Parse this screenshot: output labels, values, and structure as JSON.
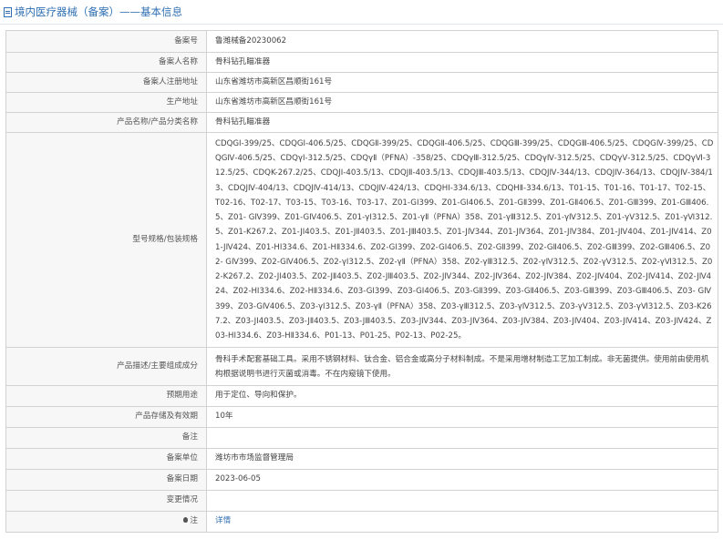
{
  "header": {
    "title": "境内医疗器械（备案）——基本信息",
    "icon": "document-icon"
  },
  "rows": [
    {
      "label": "备案号",
      "value": "鲁潍械备20230062"
    },
    {
      "label": "备案人名称",
      "value": "骨科钻孔瞄准器"
    },
    {
      "label": "备案人注册地址",
      "value": "山东省潍坊市高新区昌顺街161号"
    },
    {
      "label": "生产地址",
      "value": "山东省潍坊市高新区昌顺街161号"
    },
    {
      "label": "产品名称/产品分类名称",
      "value": "骨科钻孔瞄准器"
    },
    {
      "label": "型号规格/包装规格",
      "value": "CDQGⅠ-399/25、CDQGⅠ-406.5/25、CDQGⅡ-399/25、CDQGⅡ-406.5/25、CDQGⅢ-399/25、CDQGⅢ-406.5/25、CDQGⅣ-399/25、CDQGⅣ-406.5/25、CDQγⅠ-312.5/25、CDQγⅡ（PFNA）-358/25、CDQγⅢ-312.5/25、CDQγⅣ-312.5/25、CDQγⅤ-312.5/25、CDQγⅥ-312.5/25、CDQK-267.2/25、CDQJⅠ-403.5/13、CDQJⅡ-403.5/13、CDQJⅢ-403.5/13、CDQJⅣ-344/13、CDQJⅣ-364/13、CDQJⅣ-384/13、CDQJⅣ-404/13、CDQJⅣ-414/13、CDQJⅣ-424/13、CDQHⅠ-334.6/13、CDQHⅡ-334.6/13、T01-15、T01-16、T01-17、T02-15、T02-16、T02-17、T03-15、T03-16、T03-17、Z01-GⅠ399、Z01-GⅠ406.5、Z01-GⅡ399、Z01-GⅡ406.5、Z01-GⅢ399、Z01-GⅢ406.5、Z01- GⅣ399、Z01-GⅣ406.5、Z01-γⅠ312.5、Z01-γⅡ（PFNA）358、Z01-γⅢ312.5、Z01-γⅣ312.5、Z01-γⅤ312.5、Z01-γⅥ312.5、Z01-K267.2、Z01-JⅠ403.5、Z01-JⅡ403.5、Z01-JⅢ403.5、Z01-JⅣ344、Z01-JⅣ364、Z01-JⅣ384、Z01-JⅣ404、Z01-JⅣ414、Z01-JⅣ424、Z01-HⅠ334.6、Z01-HⅡ334.6、Z02-GⅠ399、Z02-GⅠ406.5、Z02-GⅡ399、Z02-GⅡ406.5、Z02-GⅢ399、Z02-GⅢ406.5、Z02- GⅣ399、Z02-GⅣ406.5、Z02-γⅠ312.5、Z02-γⅡ（PFNA）358、Z02-γⅢ312.5、Z02-γⅣ312.5、Z02-γⅤ312.5、Z02-γⅥ312.5、Z02-K267.2、Z02-JⅠ403.5、Z02-JⅡ403.5、Z02-JⅢ403.5、Z02-JⅣ344、Z02-JⅣ364、Z02-JⅣ384、Z02-JⅣ404、Z02-JⅣ414、Z02-JⅣ424、Z02-HⅠ334.6、Z02-HⅡ334.6、Z03-GⅠ399、Z03-GⅠ406.5、Z03-GⅡ399、Z03-GⅡ406.5、Z03-GⅢ399、Z03-GⅢ406.5、Z03- GⅣ399、Z03-GⅣ406.5、Z03-γⅠ312.5、Z03-γⅡ（PFNA）358、Z03-γⅢ312.5、Z03-γⅣ312.5、Z03-γⅤ312.5、Z03-γⅥ312.5、Z03-K267.2、Z03-JⅠ403.5、Z03-JⅡ403.5、Z03-JⅢ403.5、Z03-JⅣ344、Z03-JⅣ364、Z03-JⅣ384、Z03-JⅣ404、Z03-JⅣ414、Z03-JⅣ424、Z03-HⅠ334.6、Z03-HⅡ334.6、P01-13、P01-25、P02-13、P02-25。"
    },
    {
      "label": "产品描述/主要组成成分",
      "value": "骨科手术配套基础工具。采用不锈钢材料、钛合金、铝合金或高分子材料制成。不是采用增材制造工艺加工制成。非无菌提供。使用前由使用机构根据说明书进行灭菌或消毒。不在内窥镜下使用。"
    },
    {
      "label": "预期用途",
      "value": "用于定位、导向和保护。"
    },
    {
      "label": "产品存储及有效期",
      "value": "10年"
    },
    {
      "label": "备注",
      "value": ""
    },
    {
      "label": "备案单位",
      "value": "潍坊市市场监督管理局"
    },
    {
      "label": "备案日期",
      "value": "2023-06-05"
    },
    {
      "label": "变更情况",
      "value": ""
    },
    {
      "label": "注",
      "value": "详情",
      "icon": "lightbulb-icon"
    }
  ],
  "colors": {
    "link": "#2f6fb3",
    "label_bg": "#f7f7f7",
    "border": "#d2d2d2"
  }
}
